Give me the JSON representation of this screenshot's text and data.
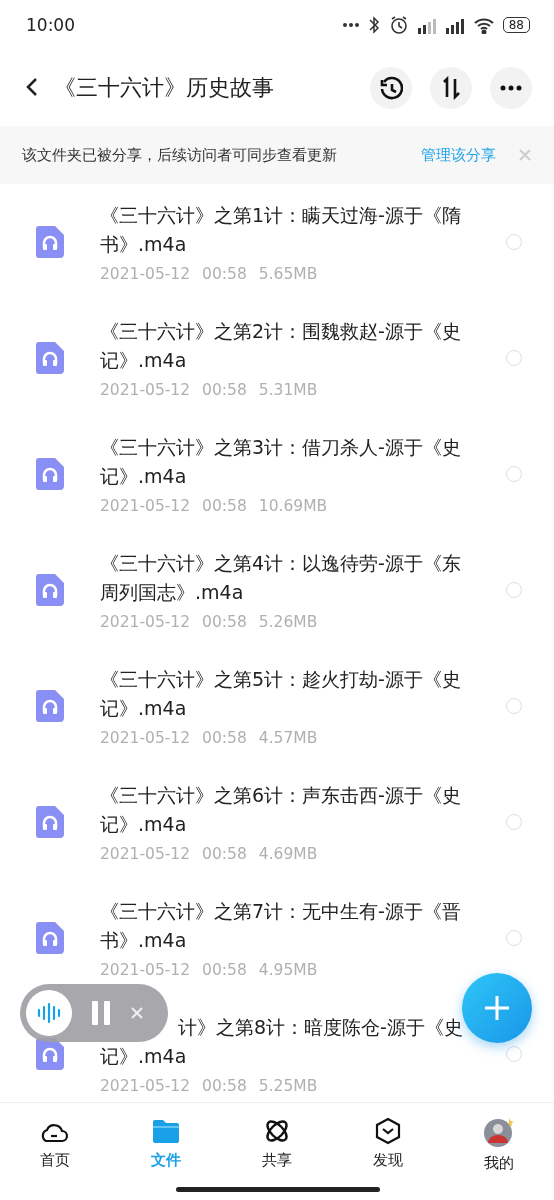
{
  "status_bar": {
    "time": "10:00",
    "battery": "88"
  },
  "header": {
    "title": "《三十六计》历史故事"
  },
  "share_banner": {
    "message": "该文件夹已被分享，后续访问者可同步查看更新",
    "action": "管理该分享"
  },
  "files": [
    {
      "name": "《三十六计》之第1计：瞒天过海-源于《隋书》.m4a",
      "date": "2021-05-12",
      "time": "00:58",
      "size": "5.65MB",
      "selected": false
    },
    {
      "name": "《三十六计》之第2计：围魏救赵-源于《史记》.m4a",
      "date": "2021-05-12",
      "time": "00:58",
      "size": "5.31MB",
      "selected": false
    },
    {
      "name": "《三十六计》之第3计：借刀杀人-源于《史记》.m4a",
      "date": "2021-05-12",
      "time": "00:58",
      "size": "10.69MB",
      "selected": false
    },
    {
      "name": "《三十六计》之第4计：以逸待劳-源于《东周列国志》.m4a",
      "date": "2021-05-12",
      "time": "00:58",
      "size": "5.26MB",
      "selected": false
    },
    {
      "name": "《三十六计》之第5计：趁火打劫-源于《史记》.m4a",
      "date": "2021-05-12",
      "time": "00:58",
      "size": "4.57MB",
      "selected": false
    },
    {
      "name": "《三十六计》之第6计：声东击西-源于《史记》.m4a",
      "date": "2021-05-12",
      "time": "00:58",
      "size": "4.69MB",
      "selected": false
    },
    {
      "name": "《三十六计》之第7计：无中生有-源于《晋书》.m4a",
      "date": "2021-05-12",
      "time": "00:58",
      "size": "4.95MB",
      "selected": false
    },
    {
      "kind": "covered",
      "name": "计》之第8计：暗度陈仓-源于《史记》.m4a",
      "date": "2021-05-12",
      "time": "00:58",
      "size": "5.25MB",
      "selected": false
    }
  ],
  "nav": [
    {
      "label": "首页",
      "kind": "home",
      "selected": false
    },
    {
      "label": "文件",
      "kind": "files",
      "selected": true
    },
    {
      "label": "共享",
      "kind": "share",
      "selected": false
    },
    {
      "label": "发现",
      "kind": "discover",
      "selected": false
    },
    {
      "label": "我的",
      "kind": "me",
      "selected": false
    }
  ]
}
